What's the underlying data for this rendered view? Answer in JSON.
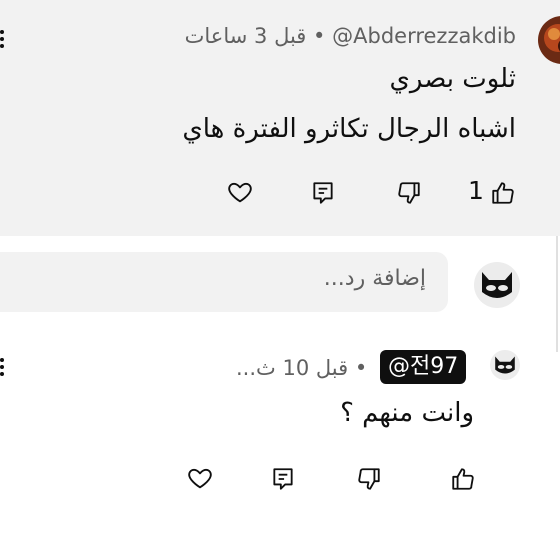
{
  "comment": {
    "author": "@Abderrezzakdib",
    "time": "قبل 3 ساعات",
    "lines": [
      "ثلوت بصري",
      "اشباه الرجال تكاثرو الفترة هاي"
    ],
    "like_count": "1"
  },
  "reply_box": {
    "placeholder": "إضافة رد..."
  },
  "reply": {
    "author": "@전97",
    "time": "قبل 10 ث...",
    "text": "وانت منهم ؟"
  },
  "separator": "•",
  "icons": {
    "like": "thumbs-up-icon",
    "dislike": "thumbs-down-icon",
    "reply": "comment-icon",
    "heart": "heart-icon",
    "menu": "more-vertical-icon"
  },
  "colors": {
    "surface": "#f2f2f2",
    "text": "#0f0f0f",
    "secondary": "#606060",
    "chip": "#0f0f0f"
  }
}
